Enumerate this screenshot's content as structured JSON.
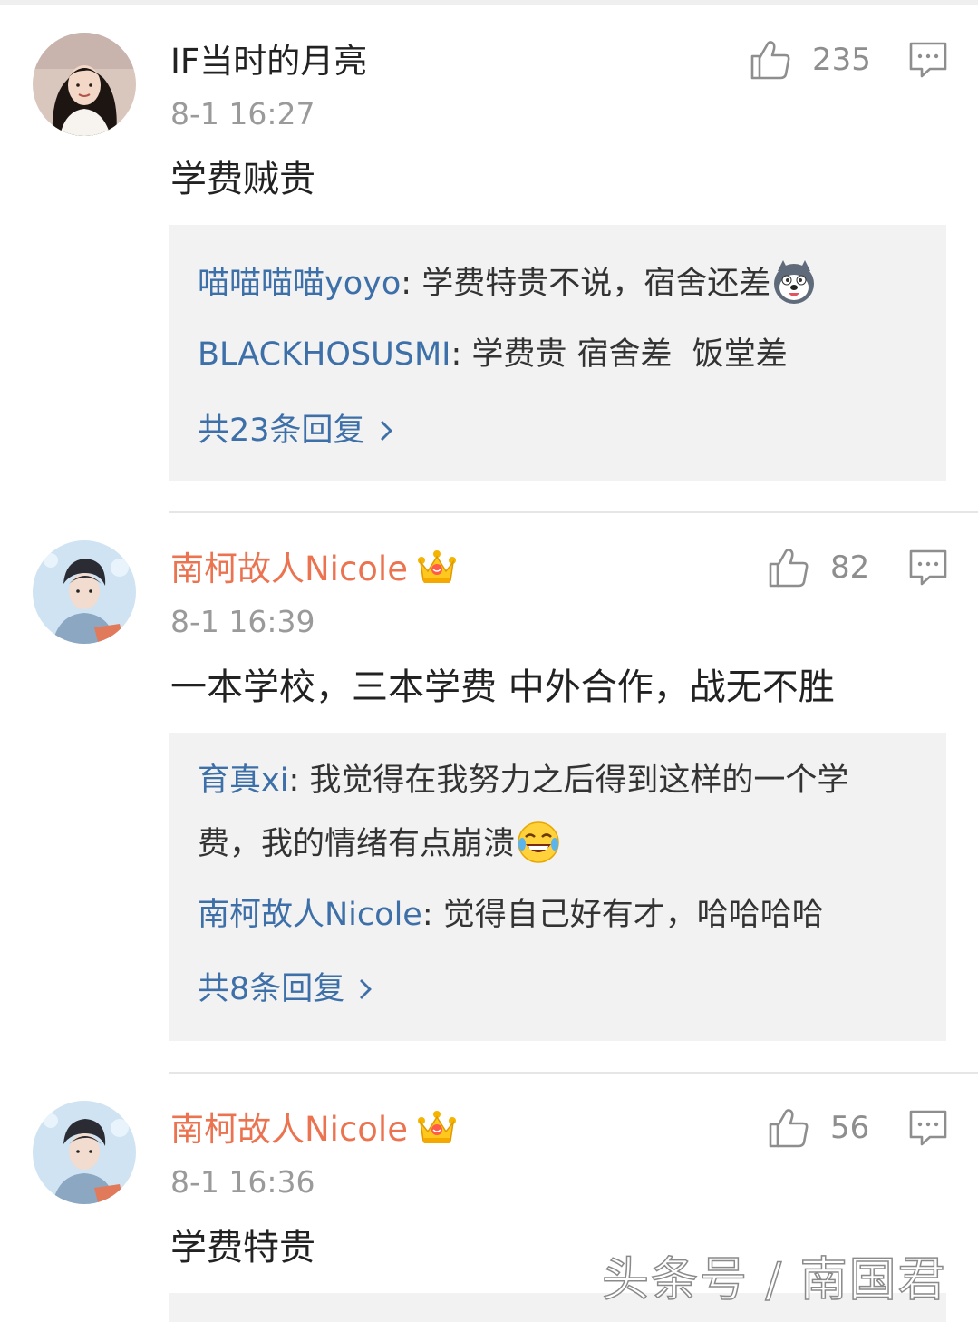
{
  "comments": [
    {
      "username": "IF当时的月亮",
      "time": "8-1 16:27",
      "likes": "235",
      "content": "学费贼贵",
      "replies": [
        {
          "user": "喵喵喵喵yoyo",
          "text": "学费特贵不说，宿舍还差"
        },
        {
          "user": "BLACKHOSUSMI",
          "text": "学费贵 宿舍差  饭堂差"
        }
      ],
      "more_label": "共23条回复"
    },
    {
      "username": "南柯故人Nicole",
      "time": "8-1 16:39",
      "likes": "82",
      "content": "一本学校，三本学费 中外合作，战无不胜",
      "replies": [
        {
          "user": "育真xi",
          "text_line1": "我觉得在我努力之后得到这样的一个学",
          "text_line2": "费，我的情绪有点崩溃"
        },
        {
          "user": "南柯故人Nicole",
          "text": "觉得自己好有才，哈哈哈哈"
        }
      ],
      "more_label": "共8条回复"
    },
    {
      "username": "南柯故人Nicole",
      "time": "8-1 16:36",
      "likes": "56",
      "content": "学费特贵"
    }
  ],
  "watermark": "头条号 / 南国君",
  "colors": {
    "vip_name": "#eb7350",
    "reply_user": "#3d6fa8",
    "reply_box_bg": "#f2f2f2",
    "meta_gray": "#9a9a9a"
  },
  "icons": {
    "like": "thumbs-up-icon",
    "reply": "comment-bubble-icon",
    "vip": "crown-icon",
    "more": "chevron-right-icon"
  }
}
